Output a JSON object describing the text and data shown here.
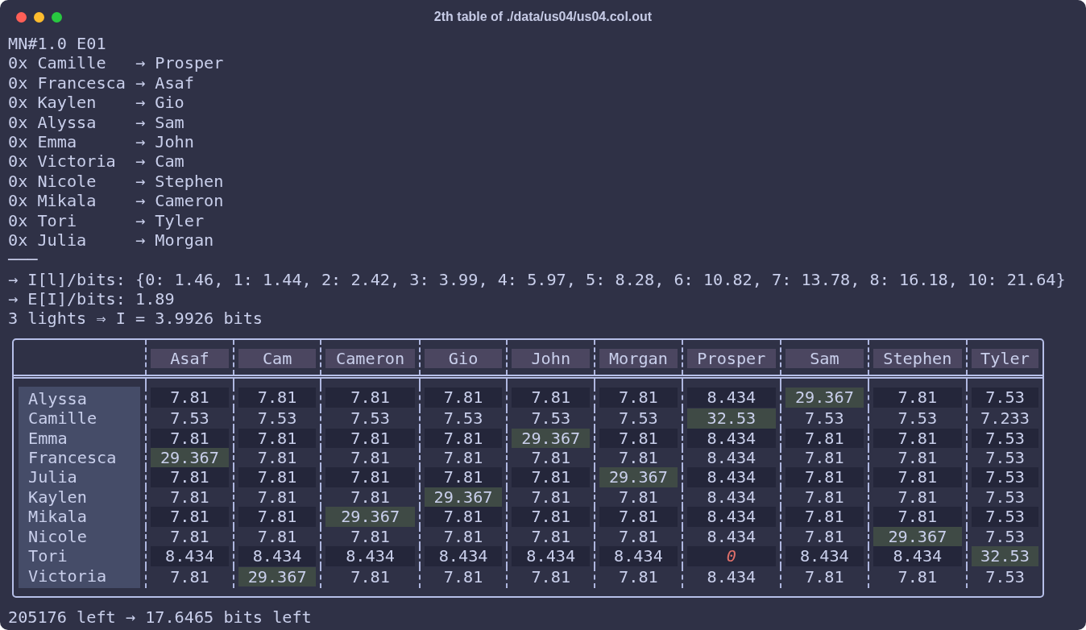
{
  "window": {
    "title": "2th table of ./data/us04/us04.col.out"
  },
  "output_lines": [
    "MN#1.0 E01",
    "0x Camille   → Prosper",
    "0x Francesca → Asaf",
    "0x Kaylen    → Gio",
    "0x Alyssa    → Sam",
    "0x Emma      → John",
    "0x Victoria  → Cam",
    "0x Nicole    → Stephen",
    "0x Mikala    → Cameron",
    "0x Tori      → Tyler",
    "0x Julia     → Morgan",
    "───",
    "→ I[l]/bits: {0: 1.46, 1: 1.44, 2: 2.42, 3: 3.99, 4: 5.97, 5: 8.28, 6: 10.82, 7: 13.78, 8: 16.18, 10: 21.64}",
    "→ E[I]/bits: 1.89",
    "3 lights ⇒ I = 3.9926 bits"
  ],
  "table": {
    "columns": [
      "Asaf",
      "Cam",
      "Cameron",
      "Gio",
      "John",
      "Morgan",
      "Prosper",
      "Sam",
      "Stephen",
      "Tyler"
    ],
    "rows": [
      {
        "name": "Alyssa",
        "cells": [
          {
            "text": "7.81",
            "kind": "normal"
          },
          {
            "text": "7.81",
            "kind": "normal"
          },
          {
            "text": "7.81",
            "kind": "normal"
          },
          {
            "text": "7.81",
            "kind": "normal"
          },
          {
            "text": "7.81",
            "kind": "normal"
          },
          {
            "text": "7.81",
            "kind": "normal"
          },
          {
            "text": "8.434",
            "kind": "normal"
          },
          {
            "text": "29.367",
            "kind": "match"
          },
          {
            "text": "7.81",
            "kind": "normal"
          },
          {
            "text": "7.53",
            "kind": "normal"
          }
        ]
      },
      {
        "name": "Camille",
        "cells": [
          {
            "text": "7.53",
            "kind": "normal"
          },
          {
            "text": "7.53",
            "kind": "normal"
          },
          {
            "text": "7.53",
            "kind": "normal"
          },
          {
            "text": "7.53",
            "kind": "normal"
          },
          {
            "text": "7.53",
            "kind": "normal"
          },
          {
            "text": "7.53",
            "kind": "normal"
          },
          {
            "text": "32.53",
            "kind": "match"
          },
          {
            "text": "7.53",
            "kind": "normal"
          },
          {
            "text": "7.53",
            "kind": "normal"
          },
          {
            "text": "7.233",
            "kind": "normal"
          }
        ]
      },
      {
        "name": "Emma",
        "cells": [
          {
            "text": "7.81",
            "kind": "normal"
          },
          {
            "text": "7.81",
            "kind": "normal"
          },
          {
            "text": "7.81",
            "kind": "normal"
          },
          {
            "text": "7.81",
            "kind": "normal"
          },
          {
            "text": "29.367",
            "kind": "match"
          },
          {
            "text": "7.81",
            "kind": "normal"
          },
          {
            "text": "8.434",
            "kind": "normal"
          },
          {
            "text": "7.81",
            "kind": "normal"
          },
          {
            "text": "7.81",
            "kind": "normal"
          },
          {
            "text": "7.53",
            "kind": "normal"
          }
        ]
      },
      {
        "name": "Francesca",
        "cells": [
          {
            "text": "29.367",
            "kind": "match"
          },
          {
            "text": "7.81",
            "kind": "normal"
          },
          {
            "text": "7.81",
            "kind": "normal"
          },
          {
            "text": "7.81",
            "kind": "normal"
          },
          {
            "text": "7.81",
            "kind": "normal"
          },
          {
            "text": "7.81",
            "kind": "normal"
          },
          {
            "text": "8.434",
            "kind": "normal"
          },
          {
            "text": "7.81",
            "kind": "normal"
          },
          {
            "text": "7.81",
            "kind": "normal"
          },
          {
            "text": "7.53",
            "kind": "normal"
          }
        ]
      },
      {
        "name": "Julia",
        "cells": [
          {
            "text": "7.81",
            "kind": "normal"
          },
          {
            "text": "7.81",
            "kind": "normal"
          },
          {
            "text": "7.81",
            "kind": "normal"
          },
          {
            "text": "7.81",
            "kind": "normal"
          },
          {
            "text": "7.81",
            "kind": "normal"
          },
          {
            "text": "29.367",
            "kind": "match"
          },
          {
            "text": "8.434",
            "kind": "normal"
          },
          {
            "text": "7.81",
            "kind": "normal"
          },
          {
            "text": "7.81",
            "kind": "normal"
          },
          {
            "text": "7.53",
            "kind": "normal"
          }
        ]
      },
      {
        "name": "Kaylen",
        "cells": [
          {
            "text": "7.81",
            "kind": "normal"
          },
          {
            "text": "7.81",
            "kind": "normal"
          },
          {
            "text": "7.81",
            "kind": "normal"
          },
          {
            "text": "29.367",
            "kind": "match"
          },
          {
            "text": "7.81",
            "kind": "normal"
          },
          {
            "text": "7.81",
            "kind": "normal"
          },
          {
            "text": "8.434",
            "kind": "normal"
          },
          {
            "text": "7.81",
            "kind": "normal"
          },
          {
            "text": "7.81",
            "kind": "normal"
          },
          {
            "text": "7.53",
            "kind": "normal"
          }
        ]
      },
      {
        "name": "Mikala",
        "cells": [
          {
            "text": "7.81",
            "kind": "normal"
          },
          {
            "text": "7.81",
            "kind": "normal"
          },
          {
            "text": "29.367",
            "kind": "match"
          },
          {
            "text": "7.81",
            "kind": "normal"
          },
          {
            "text": "7.81",
            "kind": "normal"
          },
          {
            "text": "7.81",
            "kind": "normal"
          },
          {
            "text": "8.434",
            "kind": "normal"
          },
          {
            "text": "7.81",
            "kind": "normal"
          },
          {
            "text": "7.81",
            "kind": "normal"
          },
          {
            "text": "7.53",
            "kind": "normal"
          }
        ]
      },
      {
        "name": "Nicole",
        "cells": [
          {
            "text": "7.81",
            "kind": "normal"
          },
          {
            "text": "7.81",
            "kind": "normal"
          },
          {
            "text": "7.81",
            "kind": "normal"
          },
          {
            "text": "7.81",
            "kind": "normal"
          },
          {
            "text": "7.81",
            "kind": "normal"
          },
          {
            "text": "7.81",
            "kind": "normal"
          },
          {
            "text": "8.434",
            "kind": "normal"
          },
          {
            "text": "7.81",
            "kind": "normal"
          },
          {
            "text": "29.367",
            "kind": "match"
          },
          {
            "text": "7.53",
            "kind": "normal"
          }
        ]
      },
      {
        "name": "Tori",
        "cells": [
          {
            "text": "8.434",
            "kind": "normal"
          },
          {
            "text": "8.434",
            "kind": "normal"
          },
          {
            "text": "8.434",
            "kind": "normal"
          },
          {
            "text": "8.434",
            "kind": "normal"
          },
          {
            "text": "8.434",
            "kind": "normal"
          },
          {
            "text": "8.434",
            "kind": "normal"
          },
          {
            "text": "0",
            "kind": "zero"
          },
          {
            "text": "8.434",
            "kind": "normal"
          },
          {
            "text": "8.434",
            "kind": "normal"
          },
          {
            "text": "32.53",
            "kind": "match"
          }
        ]
      },
      {
        "name": "Victoria",
        "cells": [
          {
            "text": "7.81",
            "kind": "normal"
          },
          {
            "text": "29.367",
            "kind": "match"
          },
          {
            "text": "7.81",
            "kind": "normal"
          },
          {
            "text": "7.81",
            "kind": "normal"
          },
          {
            "text": "7.81",
            "kind": "normal"
          },
          {
            "text": "7.81",
            "kind": "normal"
          },
          {
            "text": "8.434",
            "kind": "normal"
          },
          {
            "text": "7.81",
            "kind": "normal"
          },
          {
            "text": "7.81",
            "kind": "normal"
          },
          {
            "text": "7.53",
            "kind": "normal"
          }
        ]
      }
    ]
  },
  "footer_line": "205176 left → 17.6465 bits left"
}
